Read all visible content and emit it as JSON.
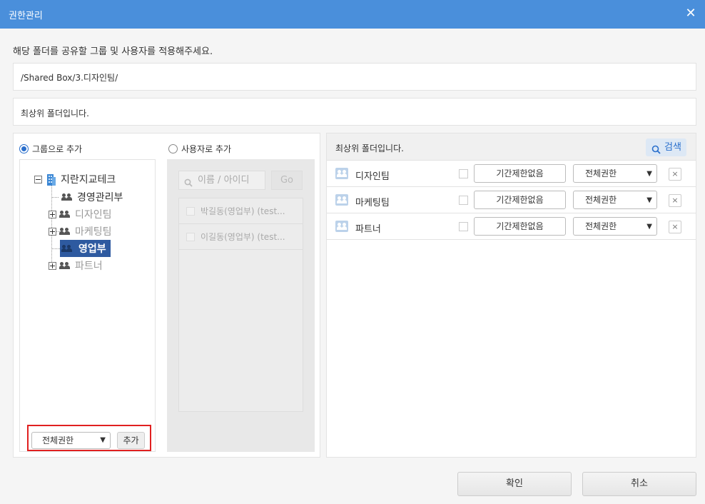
{
  "window": {
    "title": "권한관리",
    "close_glyph": "✕"
  },
  "instruction": "해당 폴더를 공유할 그룹 및 사용자를 적용해주세요.",
  "folder_path": "/Shared Box/3.디자인팀/",
  "status_message": "최상위 폴더입니다.",
  "left": {
    "radio_group_label": "그룹으로 추가",
    "radio_user_label": "사용자로 추가",
    "selected_mode": "group",
    "tree": {
      "root": "지란지교테크",
      "children": [
        {
          "label": "경영관리부",
          "expandable": false,
          "dimmed": false,
          "selected": false
        },
        {
          "label": "디자인팀",
          "expandable": true,
          "dimmed": true,
          "selected": false
        },
        {
          "label": "마케팅팀",
          "expandable": true,
          "dimmed": true,
          "selected": false
        },
        {
          "label": "영업부",
          "expandable": false,
          "dimmed": false,
          "selected": true
        },
        {
          "label": "파트너",
          "expandable": true,
          "dimmed": true,
          "selected": false
        }
      ]
    },
    "permission_select": "전체권한",
    "add_button": "추가",
    "user_search": {
      "placeholder": "이름 / 아이디",
      "go_label": "Go"
    },
    "users": [
      {
        "label": "박길동(영업부) (test..."
      },
      {
        "label": "이길동(영업부) (test..."
      }
    ]
  },
  "right": {
    "header": "최상위 폴더입니다.",
    "search_button": "검색",
    "rows": [
      {
        "name": "디자인팀",
        "period": "기간제한없음",
        "permission": "전체권한"
      },
      {
        "name": "마케팅팀",
        "period": "기간제한없음",
        "permission": "전체권한"
      },
      {
        "name": "파트너",
        "period": "기간제한없음",
        "permission": "전체권한"
      }
    ],
    "remove_glyph": "×"
  },
  "footer": {
    "confirm": "확인",
    "cancel": "취소"
  },
  "colors": {
    "titlebar": "#4a8fdb",
    "selection": "#2e5aa0",
    "highlight_border": "#e02020",
    "accent": "#2a6fcc"
  }
}
